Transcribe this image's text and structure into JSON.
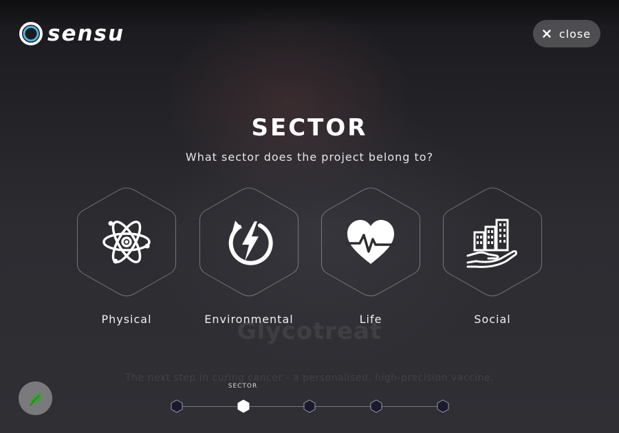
{
  "app": {
    "brand_name": "sensu",
    "brand_color": "#4fb6e3"
  },
  "header": {
    "close_label": "close",
    "close_icon": "close-icon"
  },
  "background": {
    "project_title": "Glycotreat",
    "project_subtitle": "The next step in curing cancer - a personalised, high-precision vaccine."
  },
  "main": {
    "title": "SECTOR",
    "question": "What sector does the project belong to?",
    "options": [
      {
        "label": "Physical",
        "icon": "atom-icon"
      },
      {
        "label": "Environmental",
        "icon": "energy-icon"
      },
      {
        "label": "Life",
        "icon": "heartbeat-icon"
      },
      {
        "label": "Social",
        "icon": "city-in-hand-icon"
      }
    ]
  },
  "footer": {
    "leaf_icon": "leaf-icon",
    "leaf_color": "#3f9e3a",
    "stepper": {
      "current_label": "SECTOR",
      "total_steps": 5,
      "current_step": 2
    }
  }
}
